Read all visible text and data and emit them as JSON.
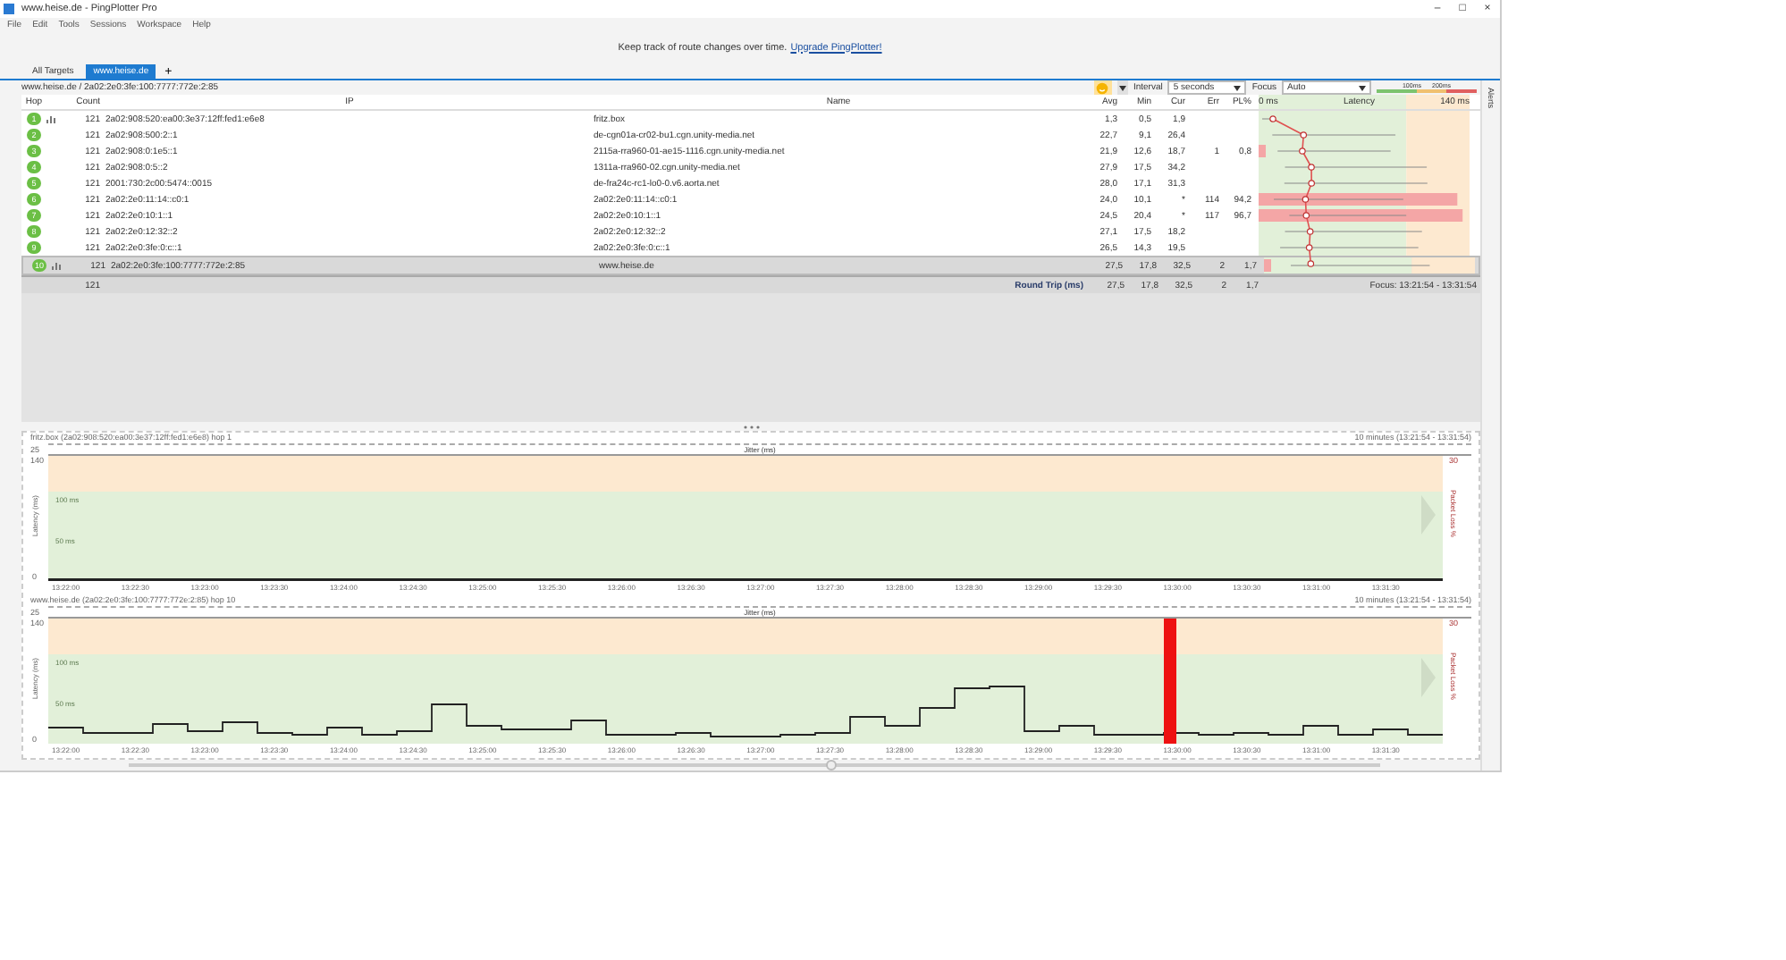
{
  "window": {
    "title": "www.heise.de - PingPlotter Pro",
    "controls": [
      "–",
      "□",
      "×"
    ]
  },
  "menu": [
    "File",
    "Edit",
    "Tools",
    "Sessions",
    "Workspace",
    "Help"
  ],
  "banner": {
    "text": "Keep track of route changes over time.",
    "link": "Upgrade PingPlotter!"
  },
  "tabs": [
    {
      "label": "All Targets",
      "selected": false
    },
    {
      "label": "www.heise.de",
      "selected": true
    }
  ],
  "tab_add": "+",
  "target": {
    "path": "www.heise.de / 2a02:2e0:3fe:100:7777:772e:2:85"
  },
  "toolbar": {
    "interval_label": "Interval",
    "interval": "5 seconds",
    "focus_label": "Focus",
    "focus": "Auto",
    "legend": [
      "100ms",
      "200ms"
    ]
  },
  "side_tab": "Alerts",
  "table": {
    "columns": [
      "Hop",
      "Count",
      "IP",
      "Name",
      "Avg",
      "Min",
      "Cur",
      "Err",
      "PL%",
      "Latency"
    ],
    "latency_scale": [
      "0 ms",
      "140 ms"
    ],
    "rows": [
      {
        "hop": "1",
        "graphed": true,
        "selected": false,
        "count": "121",
        "ip": "2a02:908:520:ea00:3e37:12ff:fed1:e6e8",
        "name": "fritz.box",
        "avg": "1,3",
        "min": "0,5",
        "cur": "1,9"
      },
      {
        "hop": "2",
        "graphed": false,
        "selected": false,
        "count": "121",
        "ip": "2a02:908:500:2::1",
        "name": "de-cgn01a-cr02-bu1.cgn.unity-media.net",
        "avg": "22,7",
        "min": "9,1",
        "cur": "26,4"
      },
      {
        "hop": "3",
        "graphed": false,
        "selected": false,
        "count": "121",
        "ip": "2a02:908:0:1e5::1",
        "name": "2115a-rra960-01-ae15-1116.cgn.unity-media.net",
        "avg": "21,9",
        "min": "12,6",
        "cur": "18,7",
        "err": "1",
        "pl": "0,8"
      },
      {
        "hop": "4",
        "graphed": false,
        "selected": false,
        "count": "121",
        "ip": "2a02:908:0:5::2",
        "name": "1311a-rra960-02.cgn.unity-media.net",
        "avg": "27,9",
        "min": "17,5",
        "cur": "34,2"
      },
      {
        "hop": "5",
        "graphed": false,
        "selected": false,
        "count": "121",
        "ip": "2001:730:2c00:5474::0015",
        "name": "de-fra24c-rc1-lo0-0.v6.aorta.net",
        "avg": "28,0",
        "min": "17,1",
        "cur": "31,3"
      },
      {
        "hop": "6",
        "graphed": false,
        "selected": false,
        "count": "121",
        "ip": "2a02:2e0:11:14::c0:1",
        "name": "2a02:2e0:11:14::c0:1",
        "avg": "24,0",
        "min": "10,1",
        "cur": "*",
        "err": "114",
        "pl": "94,2"
      },
      {
        "hop": "7",
        "graphed": false,
        "selected": false,
        "count": "121",
        "ip": "2a02:2e0:10:1::1",
        "name": "2a02:2e0:10:1::1",
        "avg": "24,5",
        "min": "20,4",
        "cur": "*",
        "err": "117",
        "pl": "96,7"
      },
      {
        "hop": "8",
        "graphed": false,
        "selected": false,
        "count": "121",
        "ip": "2a02:2e0:12:32::2",
        "name": "2a02:2e0:12:32::2",
        "avg": "27,1",
        "min": "17,5",
        "cur": "18,2"
      },
      {
        "hop": "9",
        "graphed": false,
        "selected": false,
        "count": "121",
        "ip": "2a02:2e0:3fe:0:c::1",
        "name": "2a02:2e0:3fe:0:c::1",
        "avg": "26,5",
        "min": "14,3",
        "cur": "19,5"
      },
      {
        "hop": "10",
        "graphed": true,
        "selected": true,
        "count": "121",
        "ip": "2a02:2e0:3fe:100:7777:772e:2:85",
        "name": "www.heise.de",
        "avg": "27,5",
        "min": "17,8",
        "cur": "32,5",
        "err": "2",
        "pl": "1,7"
      }
    ],
    "footer": {
      "count": "121",
      "label": "Round Trip (ms)",
      "avg": "27,5",
      "min": "17,8",
      "cur": "32,5",
      "err": "2",
      "pl": "1,7",
      "focus": "Focus: 13:21:54 - 13:31:54"
    }
  },
  "graphs": [
    {
      "title": "fritz.box (2a02:908:520:ea00:3e37:12ff:fed1:e6e8) hop 1",
      "range": "10 minutes (13:21:54 - 13:31:54)",
      "jitter_label": "Jitter (ms)",
      "jitter_max": "25",
      "y_max": "140",
      "y_marks": [
        "100 ms",
        "50 ms"
      ],
      "y_min": "0",
      "y_title": "Latency (ms)",
      "loss_max": "30",
      "loss_title": "Packet Loss %",
      "x_ticks": [
        "13:22:00",
        "13:22:30",
        "13:23:00",
        "13:23:30",
        "13:24:00",
        "13:24:30",
        "13:25:00",
        "13:25:30",
        "13:26:00",
        "13:26:30",
        "13:27:00",
        "13:27:30",
        "13:28:00",
        "13:28:30",
        "13:29:00",
        "13:29:30",
        "13:30:00",
        "13:30:30",
        "13:31:00",
        "13:31:30"
      ]
    },
    {
      "title": "www.heise.de (2a02:2e0:3fe:100:7777:772e:2:85) hop 10",
      "range": "10 minutes (13:21:54 - 13:31:54)",
      "jitter_label": "Jitter (ms)",
      "jitter_max": "25",
      "y_max": "140",
      "y_marks": [
        "100 ms",
        "50 ms"
      ],
      "y_min": "0",
      "y_title": "Latency (ms)",
      "loss_max": "30",
      "loss_title": "Packet Loss %",
      "x_ticks": [
        "13:22:00",
        "13:22:30",
        "13:23:00",
        "13:23:30",
        "13:24:00",
        "13:24:30",
        "13:25:00",
        "13:25:30",
        "13:26:00",
        "13:26:30",
        "13:27:00",
        "13:27:30",
        "13:28:00",
        "13:28:30",
        "13:29:00",
        "13:29:30",
        "13:30:00",
        "13:30:30",
        "13:31:00",
        "13:31:30"
      ]
    }
  ]
}
